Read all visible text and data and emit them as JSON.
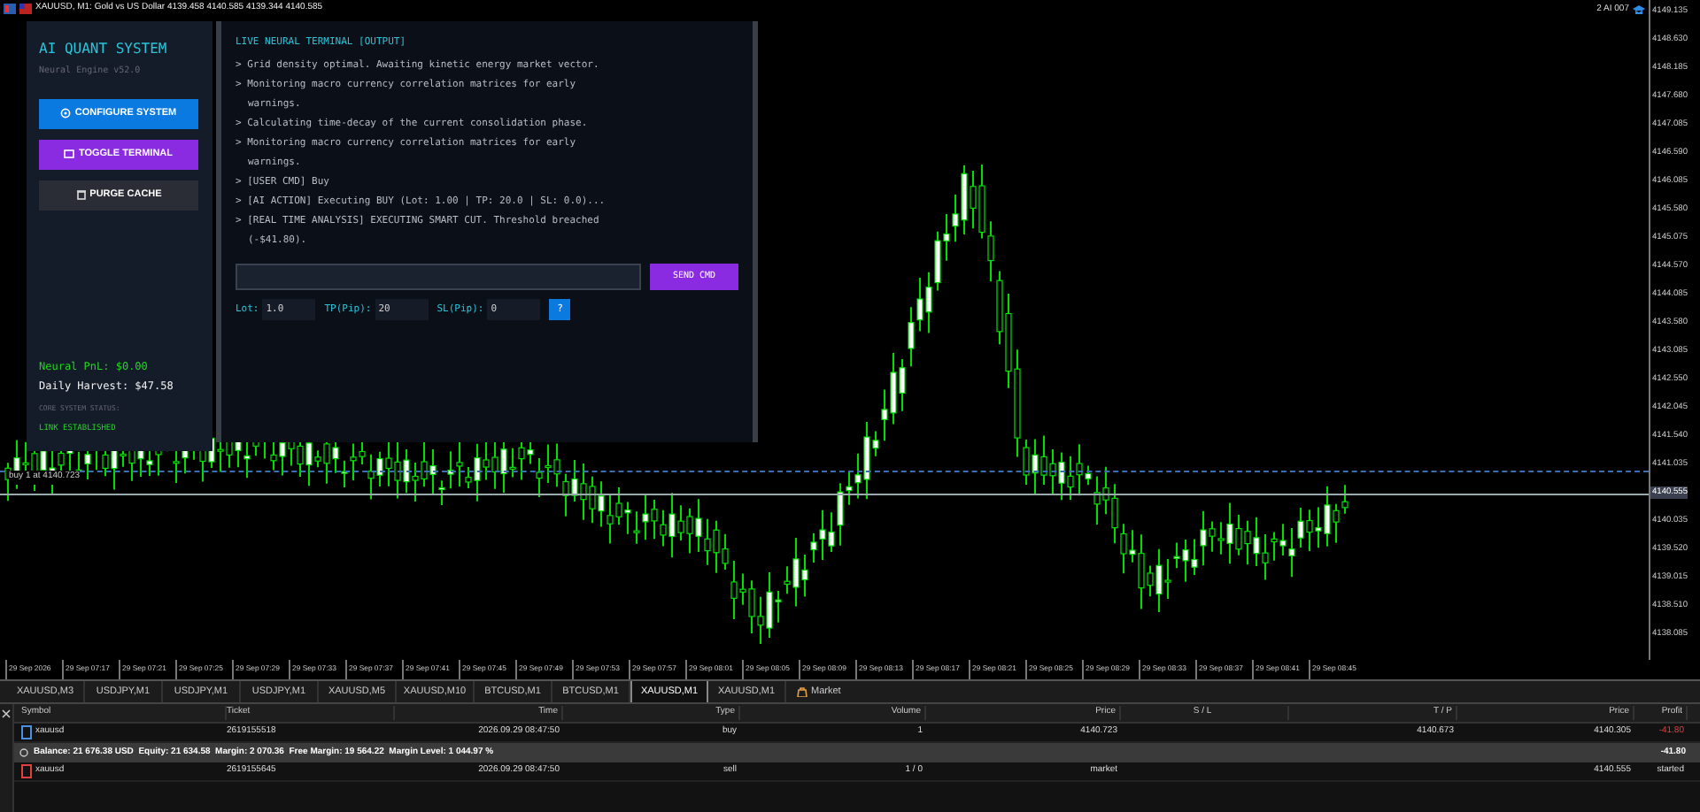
{
  "window": {
    "title": "XAUUSD, M1: Gold vs US Dollar 4139.458 4140.585 4139.344 4140.585"
  },
  "chart": {
    "account_label": "2 AI 007",
    "trade_label": "buy 1 at 4140.723",
    "price_ticks": [
      {
        "label": "4149.135",
        "highlighted": false
      },
      {
        "label": "4148.630",
        "highlighted": false
      },
      {
        "label": "4148.185",
        "highlighted": false
      },
      {
        "label": "4147.680",
        "highlighted": false
      },
      {
        "label": "4147.085",
        "highlighted": false
      },
      {
        "label": "4146.590",
        "highlighted": false
      },
      {
        "label": "4146.085",
        "highlighted": false
      },
      {
        "label": "4145.580",
        "highlighted": false
      },
      {
        "label": "4145.075",
        "highlighted": false
      },
      {
        "label": "4144.570",
        "highlighted": false
      },
      {
        "label": "4144.085",
        "highlighted": false
      },
      {
        "label": "4143.580",
        "highlighted": false
      },
      {
        "label": "4143.085",
        "highlighted": false
      },
      {
        "label": "4142.550",
        "highlighted": false
      },
      {
        "label": "4142.045",
        "highlighted": false
      },
      {
        "label": "4141.540",
        "highlighted": false
      },
      {
        "label": "4141.035",
        "highlighted": false
      },
      {
        "label": "4140.555",
        "highlighted": true
      },
      {
        "label": "4140.035",
        "highlighted": false
      },
      {
        "label": "4139.520",
        "highlighted": false
      },
      {
        "label": "4139.015",
        "highlighted": false
      },
      {
        "label": "4138.510",
        "highlighted": false
      },
      {
        "label": "4138.085",
        "highlighted": false
      }
    ],
    "time_ticks": [
      "29 Sep 2026",
      "29 Sep 07:17",
      "29 Sep 07:21",
      "29 Sep 07:25",
      "29 Sep 07:29",
      "29 Sep 07:33",
      "29 Sep 07:37",
      "29 Sep 07:41",
      "29 Sep 07:45",
      "29 Sep 07:49",
      "29 Sep 07:53",
      "29 Sep 07:57",
      "29 Sep 08:01",
      "29 Sep 08:05",
      "29 Sep 08:09",
      "29 Sep 08:13",
      "29 Sep 08:17",
      "29 Sep 08:21",
      "29 Sep 08:25",
      "29 Sep 08:29",
      "29 Sep 08:33",
      "29 Sep 08:37",
      "29 Sep 08:41",
      "29 Sep 08:45"
    ]
  },
  "control_panel": {
    "title": "AI QUANT SYSTEM",
    "subtitle": "Neural Engine v52.0",
    "buttons": [
      {
        "label": "CONFIGURE SYSTEM",
        "kind": "configure"
      },
      {
        "label": "TOGGLE TERMINAL",
        "kind": "toggle"
      },
      {
        "label": "PURGE CACHE",
        "kind": "purge"
      }
    ],
    "pnl": "Neural PnL: $0.00",
    "harvest": "Daily Harvest: $47.58",
    "status_label": "CORE SYSTEM STATUS:",
    "status": "LINK ESTABLISHED"
  },
  "terminal": {
    "title": "LIVE NEURAL TERMINAL [OUTPUT]",
    "lines": [
      "> Grid density optimal. Awaiting kinetic energy market vector.",
      "> Monitoring macro currency correlation matrices for early warnings.",
      "> Calculating time-decay of the current consolidation phase.",
      "> Monitoring macro currency correlation matrices for early warnings.",
      "> [USER CMD] Buy",
      "> [AI ACTION] Executing BUY (Lot: 1.00 | TP: 20.0 | SL: 0.0)...",
      "> [REAL TIME ANALYSIS] EXECUTING SMART CUT. Threshold breached (-$41.80)."
    ],
    "send_button": "SEND CMD",
    "params": [
      {
        "label": "Lot:",
        "value": "1.0"
      },
      {
        "label": "TP(Pip):",
        "value": "20"
      },
      {
        "label": "SL(Pip):",
        "value": "0"
      }
    ],
    "help_button": "?"
  },
  "symbol_tabs": [
    {
      "label": "XAUUSD,M3",
      "selected": false
    },
    {
      "label": "USDJPY,M1",
      "selected": false
    },
    {
      "label": "USDJPY,M1",
      "selected": false
    },
    {
      "label": "USDJPY,M1",
      "selected": false
    },
    {
      "label": "XAUUSD,M5",
      "selected": false
    },
    {
      "label": "XAUUSD,M10",
      "selected": false
    },
    {
      "label": "BTCUSD,M1",
      "selected": false
    },
    {
      "label": "BTCUSD,M1",
      "selected": false
    },
    {
      "label": "XAUUSD,M1",
      "selected": true
    },
    {
      "label": "XAUUSD,M1",
      "selected": false
    }
  ],
  "market_tab": "Market",
  "trade_table": {
    "columns": [
      "Symbol",
      "Ticket",
      "Time",
      "Type",
      "Volume",
      "Price",
      "S / L",
      "T / P",
      "Price",
      "Profit"
    ],
    "rows": [
      {
        "kind": "position",
        "cells": [
          "xauusd",
          "2619155518",
          "2026.09.29 08:47:50",
          "buy",
          "1",
          "4140.723",
          "",
          "4140.673",
          "4140.305",
          "-41.80"
        ]
      },
      {
        "kind": "summary",
        "text": "Balance: 21 676.38 USD  Equity: 21 634.58  Margin: 2 070.36  Free Margin: 19 564.22  Margin Level: 1 044.97 %",
        "total": "-41.80"
      },
      {
        "kind": "order",
        "cells": [
          "xauusd",
          "2619155645",
          "2026.09.29 08:47:50",
          "sell",
          "1 / 0",
          "market",
          "",
          "",
          "4140.555",
          "started"
        ]
      }
    ]
  }
}
